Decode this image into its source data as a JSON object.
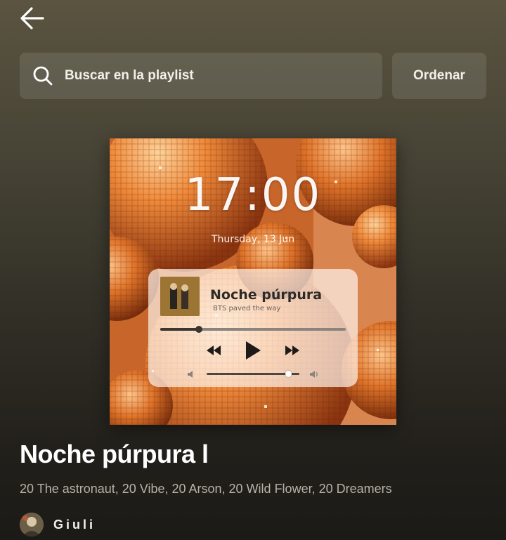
{
  "header": {
    "back_icon": "arrow-left-icon"
  },
  "search": {
    "icon": "search-icon",
    "placeholder": "Buscar en la playlist"
  },
  "sort": {
    "label": "Ordenar"
  },
  "cover": {
    "clock": "17:00",
    "date": "Thursday, 13 Jun",
    "player": {
      "track_title": "Noche púrpura",
      "track_artist": "BTS paved the way",
      "progress": 0.21,
      "volume": 0.88
    }
  },
  "playlist": {
    "title": "Noche púrpura l",
    "description": "20 The astronaut, 20 Vibe, 20 Arson, 20 Wild Flower, 20 Dreamers",
    "owner": "Giuli"
  },
  "colors": {
    "background_top": "#5a5440",
    "background_bottom": "#1b1a16",
    "description_text": "#b6b2a8",
    "accent_orange": "#d9692a"
  }
}
